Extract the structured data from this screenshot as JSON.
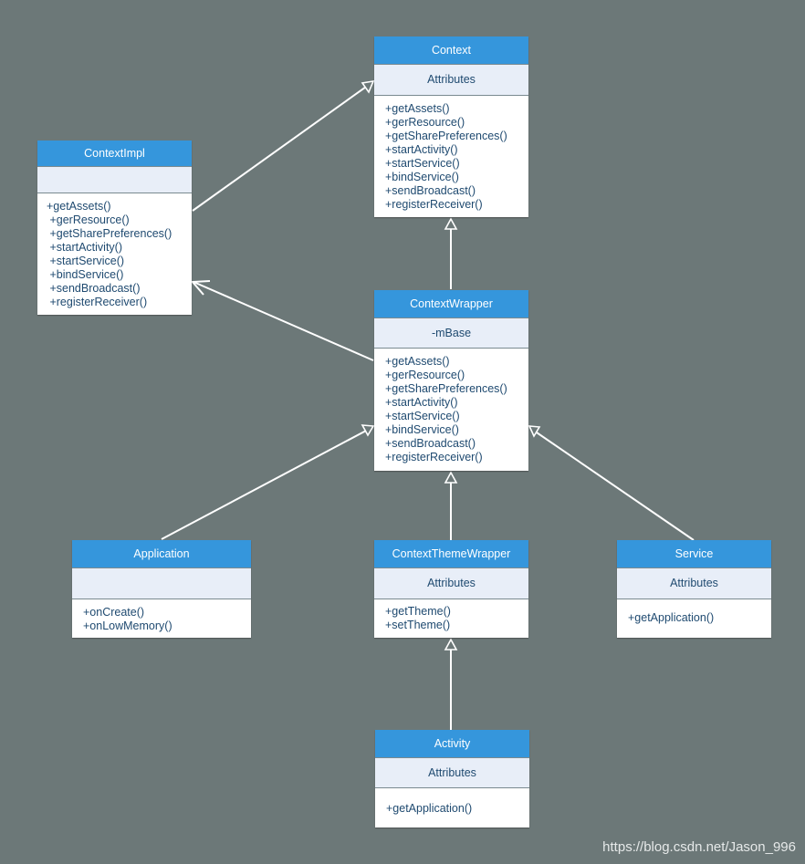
{
  "diagram": {
    "type": "UML class diagram",
    "classes": [
      {
        "id": "context",
        "name": "Context",
        "attributes": "Attributes",
        "methods": [
          "+getAssets()",
          "+gerResource()",
          "+getSharePreferences()",
          "+startActivity()",
          "+startService()",
          "+bindService()",
          "+sendBroadcast()",
          "+registerReceiver()"
        ]
      },
      {
        "id": "contextimpl",
        "name": "ContextImpl",
        "attributes": "",
        "methods": [
          "+getAssets()",
          " +gerResource()",
          " +getSharePreferences()",
          " +startActivity()",
          " +startService()",
          " +bindService()",
          " +sendBroadcast()",
          " +registerReceiver()"
        ]
      },
      {
        "id": "contextwrapper",
        "name": "ContextWrapper",
        "attributes": "-mBase",
        "methods": [
          "+getAssets()",
          "+gerResource()",
          "+getSharePreferences()",
          "+startActivity()",
          "+startService()",
          "+bindService()",
          "+sendBroadcast()",
          "+registerReceiver()"
        ]
      },
      {
        "id": "application",
        "name": "Application",
        "attributes": "",
        "methods": [
          "+onCreate()",
          "+onLowMemory()"
        ]
      },
      {
        "id": "contextthemewrapper",
        "name": "ContextThemeWrapper",
        "attributes": "Attributes",
        "methods": [
          "+getTheme()",
          "+setTheme()"
        ]
      },
      {
        "id": "service",
        "name": "Service",
        "attributes": "Attributes",
        "methods": [
          "+getApplication()"
        ]
      },
      {
        "id": "activity",
        "name": "Activity",
        "attributes": "Attributes",
        "methods": [
          "+getApplication()"
        ]
      }
    ],
    "relations": [
      {
        "from": "contextimpl",
        "to": "context",
        "kind": "generalization"
      },
      {
        "from": "contextwrapper",
        "to": "context",
        "kind": "generalization"
      },
      {
        "from": "contextwrapper",
        "to": "contextimpl",
        "kind": "association"
      },
      {
        "from": "application",
        "to": "contextwrapper",
        "kind": "generalization"
      },
      {
        "from": "contextthemewrapper",
        "to": "contextwrapper",
        "kind": "generalization"
      },
      {
        "from": "service",
        "to": "contextwrapper",
        "kind": "generalization"
      },
      {
        "from": "activity",
        "to": "contextthemewrapper",
        "kind": "generalization"
      }
    ]
  },
  "colors": {
    "background": "#6c7878",
    "header": "#3596dc",
    "attributes_bg": "#e8eef8",
    "text": "#1f4a70",
    "connector": "#ffffff"
  },
  "watermark": "https://blog.csdn.net/Jason_996"
}
